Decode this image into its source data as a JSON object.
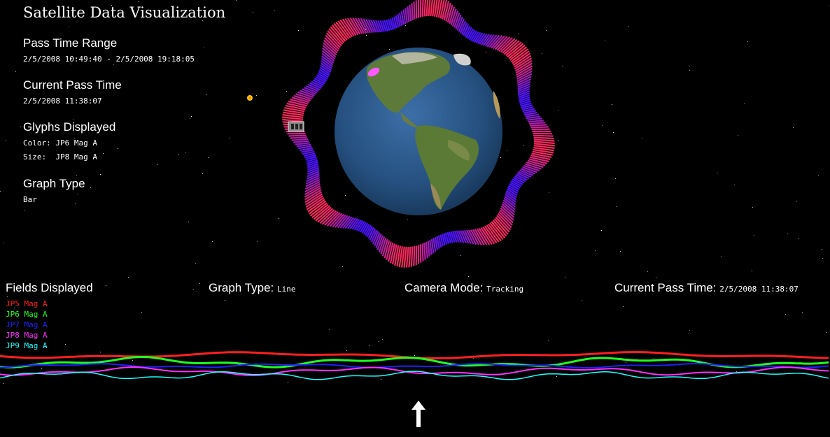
{
  "title": "Satellite Data Visualization",
  "pass_time_range": {
    "heading": "Pass Time Range",
    "value": "2/5/2008 10:49:40 - 2/5/2008 19:18:05"
  },
  "current_pass_time": {
    "heading": "Current Pass Time",
    "value": "2/5/2008 11:38:07"
  },
  "glyphs": {
    "heading": "Glyphs Displayed",
    "color": "Color: JP6 Mag A",
    "size": "Size:  JP8 Mag A"
  },
  "graph_type_top": {
    "heading": "Graph Type",
    "value": "Bar"
  },
  "bottom": {
    "fields_heading": "Fields Displayed",
    "fields": [
      {
        "label": "JP5 Mag A",
        "color": "#ff2020"
      },
      {
        "label": "JP6 Mag A",
        "color": "#20ff20"
      },
      {
        "label": "JP7 Mag A",
        "color": "#2020ff"
      },
      {
        "label": "JP8 Mag A",
        "color": "#ff30ff"
      },
      {
        "label": "JP9 Mag A",
        "color": "#20ffff"
      }
    ],
    "graph_type_label": "Graph Type:",
    "graph_type_value": "Line",
    "camera_mode_label": "Camera Mode:",
    "camera_mode_value": "Tracking",
    "current_pass_label": "Current Pass Time:",
    "current_pass_value": "2/5/2008 11:38:07"
  },
  "icons": {
    "sun": "sun-icon",
    "satellite": "satellite-icon",
    "arrow": "current-time-arrow-icon"
  }
}
